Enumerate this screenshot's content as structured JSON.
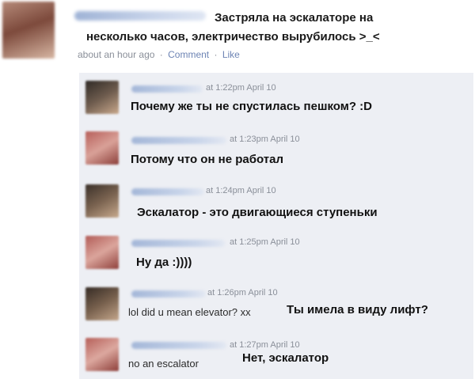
{
  "post": {
    "text_line1": "Застряла на эскалаторе на",
    "text_line2": "несколько часов, электричество вырубилось >_<",
    "time": "about an hour ago",
    "separator": "·",
    "comment_link": "Comment",
    "like_link": "Like"
  },
  "comments": [
    {
      "time": "at 1:22pm April 10",
      "translation": "Почему же ты не спустилась пешком? :D",
      "original": ""
    },
    {
      "time": "at 1:23pm April 10",
      "translation": "Потому что он не работал",
      "original": ""
    },
    {
      "time": "at 1:24pm April 10",
      "translation": "Эскалатор - это двигающиеся ступеньки",
      "original": ""
    },
    {
      "time": "at 1:25pm April 10",
      "translation": "Ну да :))))",
      "original": ""
    },
    {
      "time": "at 1:26pm April 10",
      "translation": "Ты имела в виду лифт?",
      "original": "lol did u mean elevator? xx"
    },
    {
      "time": "at 1:27pm April 10",
      "translation": "Нет, эскалатор",
      "original": "no an escalator"
    }
  ],
  "colors": {
    "comment_bg": "#edeff4",
    "link": "#6d84b4",
    "meta_gray": "#8a8f99"
  }
}
